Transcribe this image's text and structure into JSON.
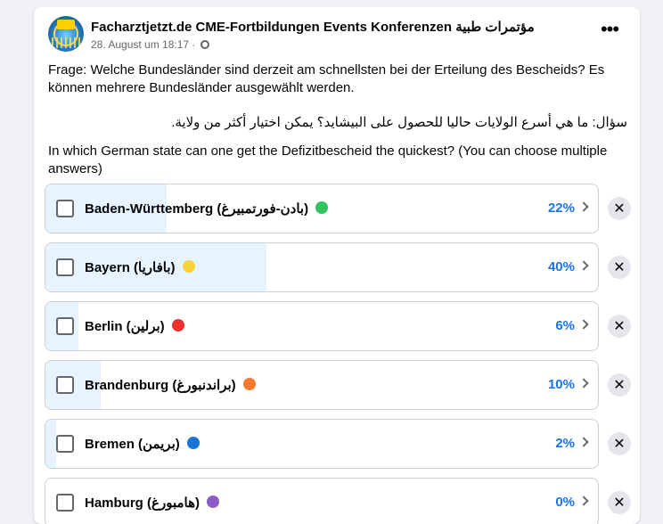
{
  "post": {
    "page_name": "Facharztjetzt.de CME-Fortbildungen Events Konferenzen مؤتمرات طبية",
    "date": "28. August um 18:17",
    "separator": "·",
    "more": "•••",
    "question_de": "Frage: Welche Bundesländer sind derzeit am schnellsten bei der Erteilung des Bescheids? Es können mehrere Bundesländer ausgewählt werden.",
    "question_ar": "سؤال: ما هي أسرع الولايات حاليا للحصول على البيشايد؟ يمكن اختيار أكثر من ولاية.",
    "question_en": "In which German state can one get the Defizitbescheid the  quickest? (You can choose multiple answers)"
  },
  "poll": {
    "options": [
      {
        "label": "Baden-Württemberg (بادن-فورتمبيرغ)",
        "percent": "22%",
        "fill": 0.22,
        "color": "#31c463"
      },
      {
        "label": "Bayern (بافاريا)",
        "percent": "40%",
        "fill": 0.4,
        "color": "#f7d23a"
      },
      {
        "label": "Berlin (برلين)",
        "percent": "6%",
        "fill": 0.06,
        "color": "#f0302d"
      },
      {
        "label": "Brandenburg (براندنبورغ)",
        "percent": "10%",
        "fill": 0.1,
        "color": "#f5782d"
      },
      {
        "label": "Bremen (بريمن)",
        "percent": "2%",
        "fill": 0.02,
        "color": "#1976d2"
      },
      {
        "label": "Hamburg (هامبورغ)",
        "percent": "0%",
        "fill": 0.0,
        "color": "#8e5bc4"
      }
    ],
    "remove_symbol": "✕"
  }
}
